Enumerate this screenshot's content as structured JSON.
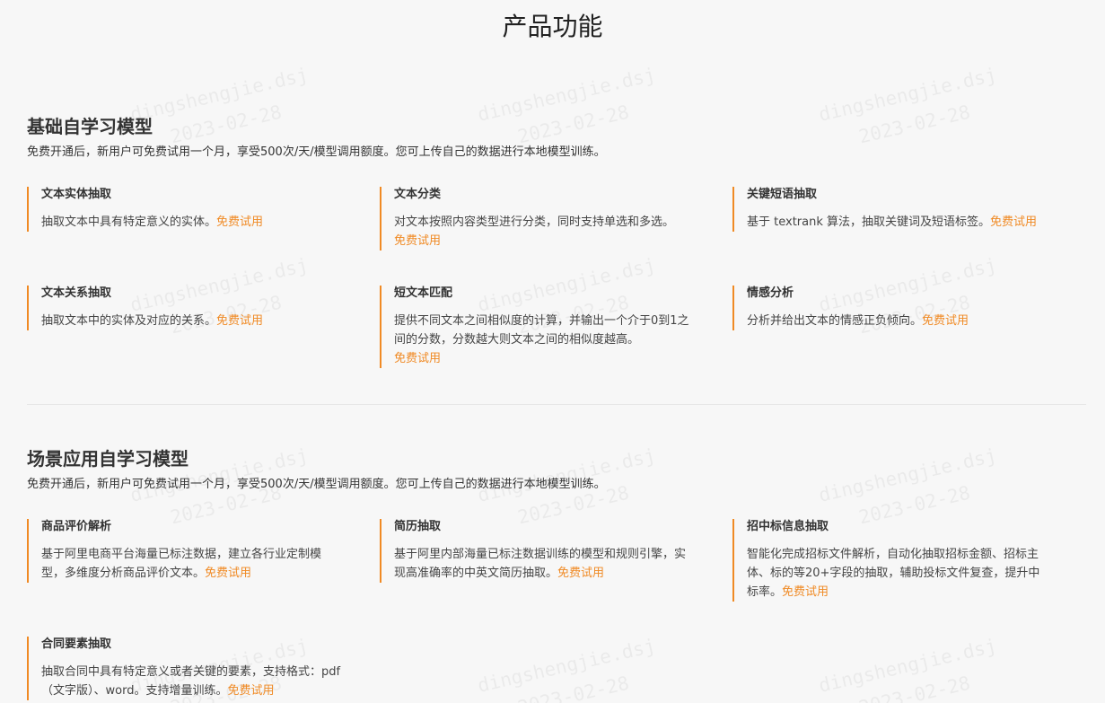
{
  "page": {
    "title": "产品功能"
  },
  "try_label": "免费试用",
  "watermark": {
    "line1": "dingshengjie.dsj",
    "line2": "2023-02-28"
  },
  "colors": {
    "accent": "#f08a24",
    "background": "#f7f7f7",
    "divider": "#e6e6e6"
  },
  "sections": [
    {
      "title": "基础自学习模型",
      "desc": "免费开通后，新用户可免费试用一个月，享受500次/天/模型调用额度。您可上传自己的数据进行本地模型训练。",
      "cards": [
        {
          "title": "文本实体抽取",
          "desc": "抽取文本中具有特定意义的实体。"
        },
        {
          "title": "文本分类",
          "desc": "对文本按照内容类型进行分类，同时支持单选和多选。"
        },
        {
          "title": "关键短语抽取",
          "desc": "基于 textrank 算法，抽取关键词及短语标签。"
        },
        {
          "title": "文本关系抽取",
          "desc": "抽取文本中的实体及对应的关系。"
        },
        {
          "title": "短文本匹配",
          "desc": "提供不同文本之间相似度的计算，并输出一个介于0到1之间的分数，分数越大则文本之间的相似度越高。"
        },
        {
          "title": "情感分析",
          "desc": "分析并给出文本的情感正负倾向。"
        }
      ]
    },
    {
      "title": "场景应用自学习模型",
      "desc": "免费开通后，新用户可免费试用一个月，享受500次/天/模型调用额度。您可上传自己的数据进行本地模型训练。",
      "cards": [
        {
          "title": "商品评价解析",
          "desc": "基于阿里电商平台海量已标注数据，建立各行业定制模型，多维度分析商品评价文本。"
        },
        {
          "title": "简历抽取",
          "desc": "基于阿里内部海量已标注数据训练的模型和规则引擎，实现高准确率的中英文简历抽取。"
        },
        {
          "title": "招中标信息抽取",
          "desc": "智能化完成招标文件解析，自动化抽取招标金额、招标主体、标的等20+字段的抽取，辅助投标文件复查，提升中标率。"
        },
        {
          "title": "合同要素抽取",
          "desc": "抽取合同中具有特定意义或者关键的要素，支持格式：pdf（文字版）、word。支持增量训练。"
        }
      ]
    }
  ]
}
